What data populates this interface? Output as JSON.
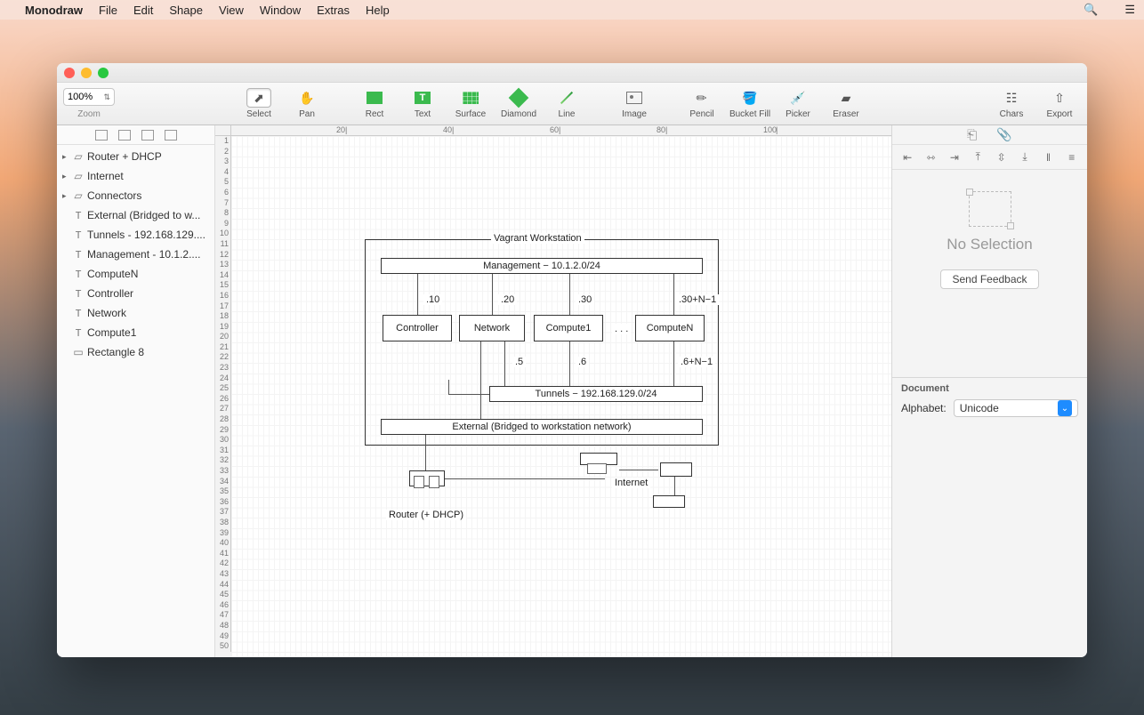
{
  "menubar": {
    "app": "Monodraw",
    "items": [
      "File",
      "Edit",
      "Shape",
      "View",
      "Window",
      "Extras",
      "Help"
    ]
  },
  "zoom": {
    "value": "100%",
    "label": "Zoom"
  },
  "toolbar": {
    "select": "Select",
    "pan": "Pan",
    "rect": "Rect",
    "text": "Text",
    "surface": "Surface",
    "diamond": "Diamond",
    "line": "Line",
    "image": "Image",
    "pencil": "Pencil",
    "bucket": "Bucket Fill",
    "picker": "Picker",
    "eraser": "Eraser",
    "chars": "Chars",
    "export": "Export"
  },
  "sidebar": {
    "items": [
      {
        "type": "group",
        "label": "Router + DHCP"
      },
      {
        "type": "group",
        "label": "Internet"
      },
      {
        "type": "group",
        "label": "Connectors"
      },
      {
        "type": "text",
        "label": "External (Bridged to w..."
      },
      {
        "type": "text",
        "label": "Tunnels - 192.168.129...."
      },
      {
        "type": "text",
        "label": "Management - 10.1.2...."
      },
      {
        "type": "text",
        "label": "ComputeN"
      },
      {
        "type": "text",
        "label": "Controller"
      },
      {
        "type": "text",
        "label": "Network"
      },
      {
        "type": "text",
        "label": "Compute1"
      },
      {
        "type": "rect",
        "label": "Rectangle 8"
      }
    ]
  },
  "hruler": {
    "marks": [
      "20",
      "40",
      "60",
      "80",
      "100"
    ]
  },
  "vruler_rows": 50,
  "diagram": {
    "frame_title": "Vagrant Workstation",
    "management": "Management − 10.1.2.0/24",
    "ip10": ".10",
    "ip20": ".20",
    "ip30": ".30",
    "ip30n": ".30+N−1",
    "controller": "Controller",
    "network": "Network",
    "compute1": "Compute1",
    "dots": ". . .",
    "computen": "ComputeN",
    "ip5": ".5",
    "ip6": ".6",
    "ip6n": ".6+N−1",
    "tunnels": "Tunnels − 192.168.129.0/24",
    "external": "External (Bridged to workstation network)",
    "router": "Router (+ DHCP)",
    "internet": "Internet"
  },
  "inspector": {
    "no_selection": "No Selection",
    "feedback": "Send Feedback",
    "doc_title": "Document",
    "alphabet_label": "Alphabet:",
    "alphabet_value": "Unicode"
  }
}
